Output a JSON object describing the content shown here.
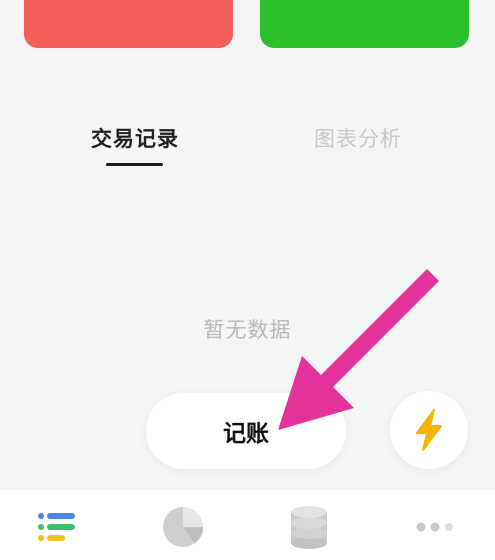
{
  "tabs": [
    {
      "label": "交易记录",
      "active": true
    },
    {
      "label": "图表分析",
      "active": false
    }
  ],
  "empty_state": {
    "text": "暂无数据"
  },
  "actions": {
    "record_label": "记账",
    "quick_icon": "lightning-icon"
  },
  "bottom_nav": {
    "items": [
      {
        "icon": "list-icon"
      },
      {
        "icon": "pie-chart-icon"
      },
      {
        "icon": "database-icon"
      },
      {
        "icon": "more-dots-icon"
      }
    ]
  },
  "colors": {
    "card_red": "#f45f5a",
    "card_green": "#2cc02c",
    "annotation_arrow": "#e3339b",
    "lightning": "#f5b400"
  }
}
